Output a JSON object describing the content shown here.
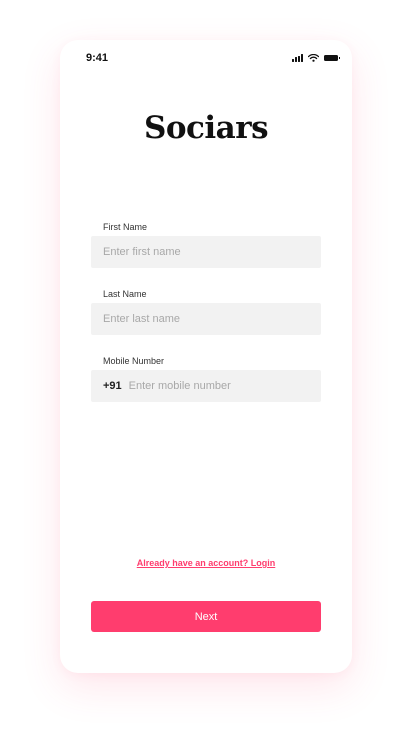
{
  "status_bar": {
    "time": "9:41",
    "icons": [
      "signal-icon",
      "wifi-icon",
      "battery-icon"
    ]
  },
  "app": {
    "logo_text": "Sociars"
  },
  "form": {
    "first_name": {
      "label": "First Name",
      "placeholder": "Enter first name",
      "value": ""
    },
    "last_name": {
      "label": "Last Name",
      "placeholder": "Enter last name",
      "value": ""
    },
    "mobile": {
      "label": "Mobile Number",
      "country_code": "+91",
      "placeholder": "Enter mobile number",
      "value": ""
    }
  },
  "login_link_text": "Already have an account? Login",
  "next_button_label": "Next",
  "colors": {
    "accent": "#ff3d6e",
    "input_background": "#f2f2f2",
    "placeholder_text": "#a8a8a8",
    "text_dark": "#111111"
  }
}
